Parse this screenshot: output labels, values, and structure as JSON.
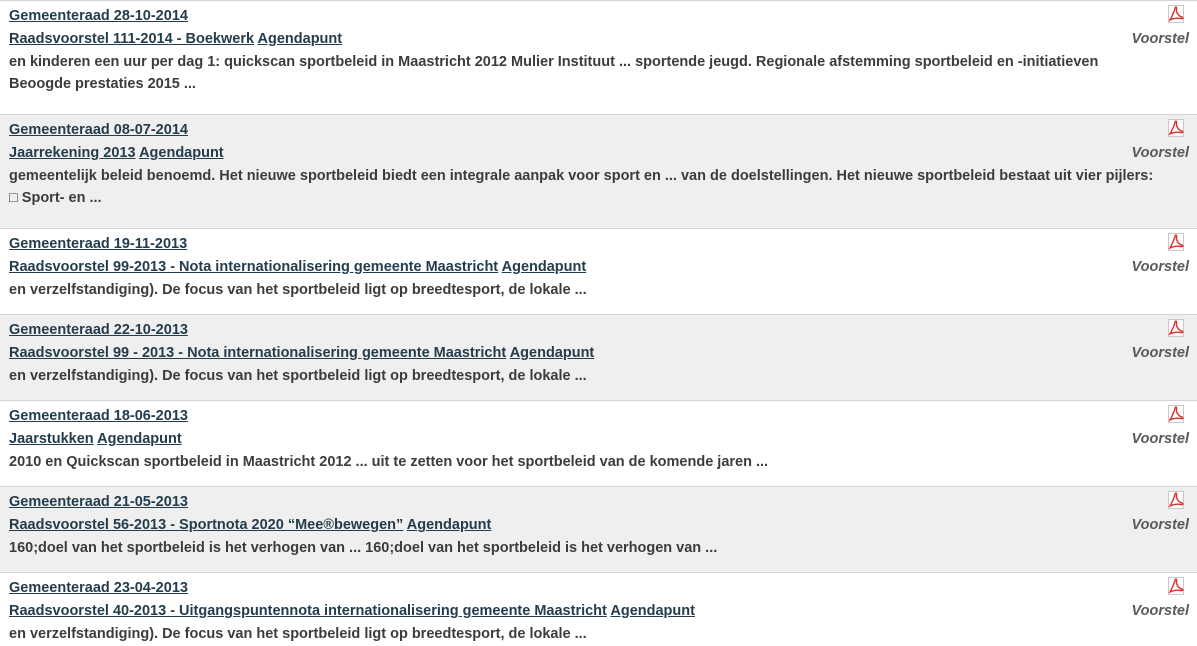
{
  "results": [
    {
      "meeting": "Gemeenteraad 28-10-2014",
      "doc": "Raadsvoorstel 111-2014 - Boekwerk",
      "agenda": "Agendapunt",
      "type": "Voorstel",
      "snippet": "en kinderen een uur per dag 1: quickscan sportbeleid in Maastricht 2012 Mulier Instituut ... sportende jeugd. Regionale afstemming sportbeleid en -initiatieven Beoogde prestaties 2015 ..."
    },
    {
      "meeting": "Gemeenteraad 08-07-2014",
      "doc": "Jaarrekening 2013",
      "agenda": "Agendapunt",
      "type": "Voorstel",
      "snippet": "gemeentelijk beleid benoemd. Het nieuwe sportbeleid biedt een integrale aanpak voor sport en ... van de doelstellingen. Het nieuwe sportbeleid bestaat uit vier pijlers: □ Sport- en ..."
    },
    {
      "meeting": "Gemeenteraad 19-11-2013",
      "doc": "Raadsvoorstel 99-2013 - Nota internationalisering gemeente Maastricht",
      "agenda": "Agendapunt",
      "type": "Voorstel",
      "snippet": "en verzelfstandiging). De focus van het sportbeleid ligt op breedtesport, de lokale ..."
    },
    {
      "meeting": "Gemeenteraad 22-10-2013",
      "doc": "Raadsvoorstel 99 - 2013 - Nota internationalisering gemeente Maastricht",
      "agenda": "Agendapunt",
      "type": "Voorstel",
      "snippet": "en verzelfstandiging). De focus van het sportbeleid ligt op breedtesport, de lokale ..."
    },
    {
      "meeting": "Gemeenteraad 18-06-2013",
      "doc": "Jaarstukken",
      "agenda": "Agendapunt",
      "type": "Voorstel",
      "snippet": "2010  en Quickscan sportbeleid in Maastricht 2012  ... uit te  zetten voor het sportbeleid van de komende jaren ..."
    },
    {
      "meeting": "Gemeenteraad 21-05-2013",
      "doc": "Raadsvoorstel 56-2013 - Sportnota 2020 “Mee®bewegen”",
      "agenda": "Agendapunt",
      "type": "Voorstel",
      "snippet": "160;doel van het sportbeleid is het verhogen van ... 160;doel van het sportbeleid is het verhogen van ..."
    },
    {
      "meeting": "Gemeenteraad 23-04-2013",
      "doc": "Raadsvoorstel 40-2013 - Uitgangspuntennota internationalisering gemeente Maastricht",
      "agenda": "Agendapunt",
      "type": "Voorstel",
      "snippet": "en verzelfstandiging). De focus van het sportbeleid ligt op breedtesport, de lokale ..."
    }
  ],
  "icons": {
    "document": "pdf-icon"
  },
  "colors": {
    "link": "#233d4d",
    "row_alt_bg": "#efefef",
    "pdf_red": "#d9302c"
  }
}
